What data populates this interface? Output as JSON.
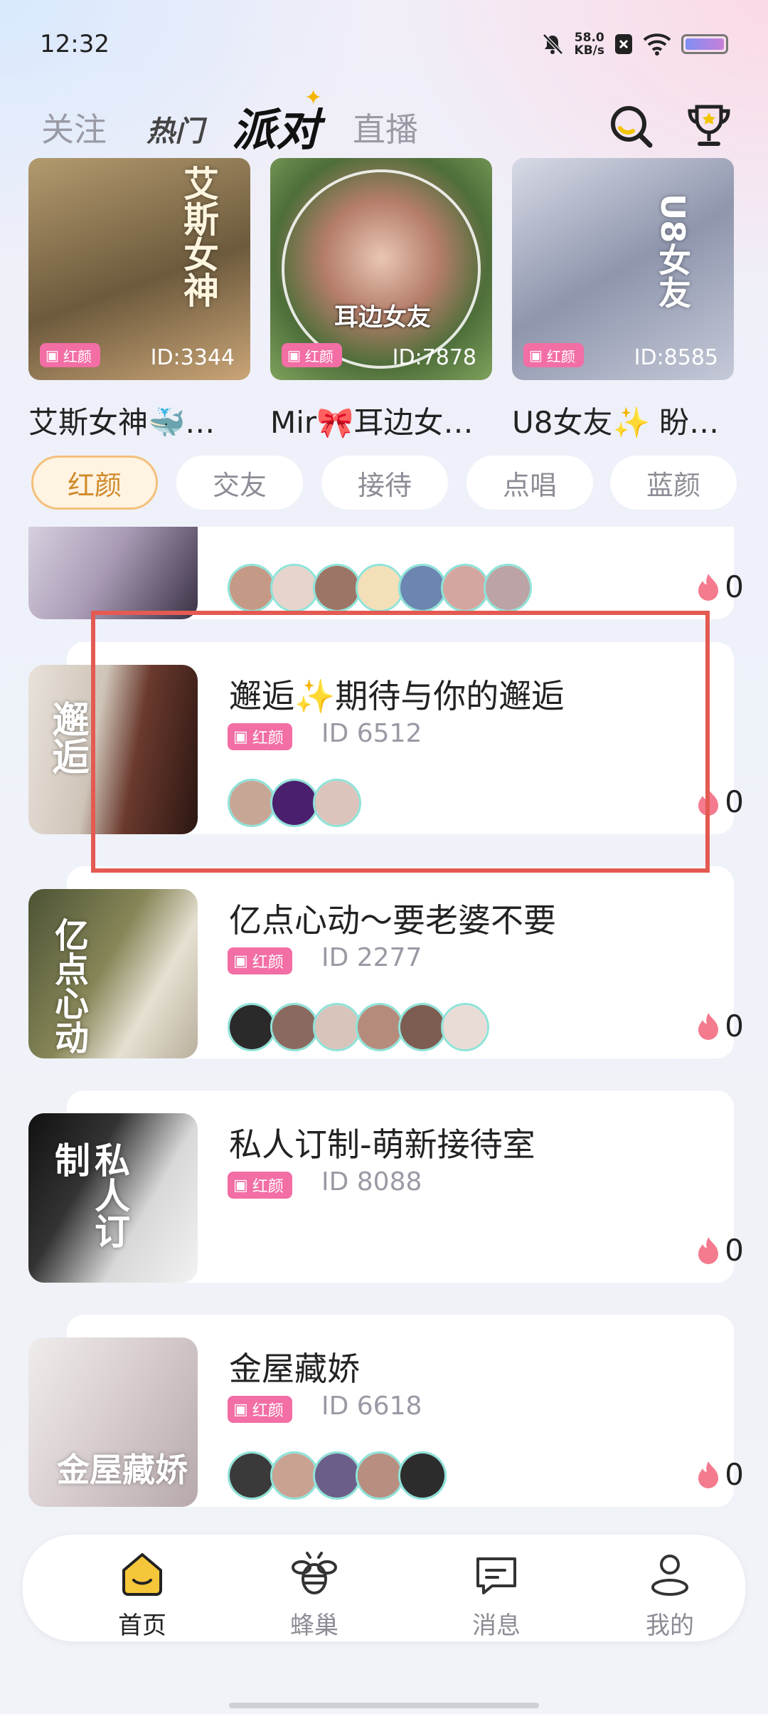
{
  "status_bar": {
    "time": "12:32",
    "net_speed_value": "58.0",
    "net_speed_unit": "KB/s"
  },
  "top_tabs": [
    {
      "label": "关注"
    },
    {
      "label": "热门"
    },
    {
      "label": "派对"
    },
    {
      "label": "直播"
    }
  ],
  "active_tab": "派对",
  "featured": [
    {
      "title": "艾斯女神🐳…",
      "tag": "红颜",
      "id": "ID:3344",
      "cover_text": "艾斯女神"
    },
    {
      "title": "Mir🎀耳边女…",
      "tag": "红颜",
      "id": "ID:7878",
      "cover_text": "耳边女友"
    },
    {
      "title": "U8女友✨ 盼…",
      "tag": "红颜",
      "id": "ID:8585",
      "cover_text": "U8女友"
    }
  ],
  "categories": [
    {
      "label": "红颜"
    },
    {
      "label": "交友"
    },
    {
      "label": "接待"
    },
    {
      "label": "点唱"
    },
    {
      "label": "蓝颜"
    }
  ],
  "active_category": "红颜",
  "rooms": [
    {
      "title": "",
      "tag": "",
      "id": "",
      "heat": "0",
      "avatars": 7
    },
    {
      "title": "邂逅✨期待与你的邂逅",
      "tag": "红颜",
      "id": "ID 6512",
      "heat": "0",
      "cover_text": "邂逅",
      "avatars": 3
    },
    {
      "title": "亿点心动～要老婆不要",
      "tag": "红颜",
      "id": "ID 2277",
      "heat": "0",
      "cover_text": "亿点心动",
      "avatars": 6
    },
    {
      "title": "私人订制-萌新接待室",
      "tag": "红颜",
      "id": "ID 8088",
      "heat": "0",
      "cover_text": "私人订制",
      "avatars": 0
    },
    {
      "title": "金屋藏娇",
      "tag": "红颜",
      "id": "ID 6618",
      "heat": "0",
      "cover_text": "金屋藏娇",
      "avatars": 5
    }
  ],
  "bottom_nav": [
    {
      "label": "首页",
      "icon": "home-icon"
    },
    {
      "label": "蜂巢",
      "icon": "bee-icon"
    },
    {
      "label": "消息",
      "icon": "message-icon"
    },
    {
      "label": "我的",
      "icon": "profile-icon"
    }
  ],
  "active_nav": "首页",
  "colors": {
    "accent_pink": "#f26ea5",
    "highlight_box": "#e45a52",
    "active_category_border": "#f4c07c",
    "avatar_ring": "#8fe3d8"
  }
}
